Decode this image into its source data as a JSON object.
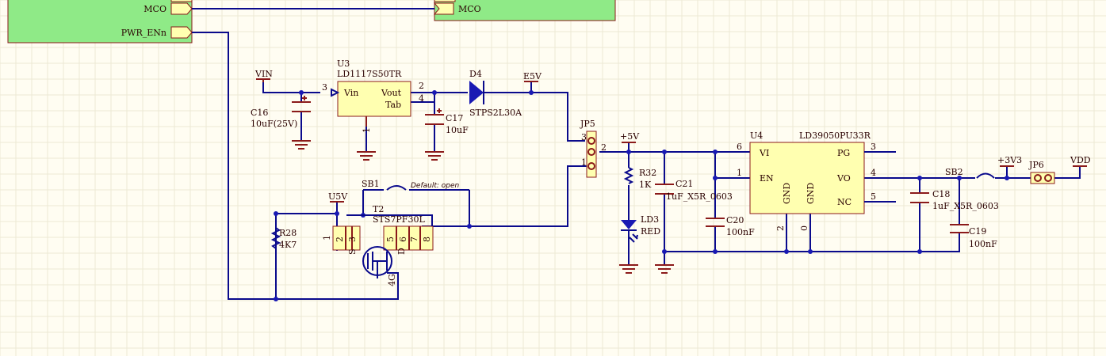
{
  "ports": {
    "mco_left": "MCO",
    "pwr_enn": "PWR_ENn",
    "mco_right": "MCO"
  },
  "nets": {
    "vin": "VIN",
    "e5v": "E5V",
    "u5v": "U5V",
    "p5v": "+5V",
    "p3v3": "+3V3",
    "vdd": "VDD"
  },
  "u3": {
    "ref": "U3",
    "value": "LD1117S50TR",
    "pin_vin": "Vin",
    "pin_vout": "Vout",
    "pin_tab": "Tab",
    "pin3": "3",
    "pin2": "2",
    "pin4": "4",
    "pin1": "1"
  },
  "c16": {
    "ref": "C16",
    "value": "10uF(25V)"
  },
  "c17": {
    "ref": "C17",
    "value": "10uF"
  },
  "d4": {
    "ref": "D4",
    "value": "STPS2L30A"
  },
  "jp5": {
    "ref": "JP5",
    "pin3": "3",
    "pin2": "2",
    "pin1": "1"
  },
  "sb1": {
    "ref": "SB1",
    "note": "Default: open"
  },
  "t2": {
    "ref": "T2",
    "value": "STS7PF30L",
    "pins": [
      "1",
      "2",
      "3",
      "5",
      "6",
      "7",
      "8"
    ],
    "s": "S",
    "d": "D",
    "g": "4G"
  },
  "r28": {
    "ref": "R28",
    "value": "4K7"
  },
  "r32": {
    "ref": "R32",
    "value": "1K"
  },
  "ld3": {
    "ref": "LD3",
    "value": "RED"
  },
  "c21": {
    "ref": "C21",
    "value": "1uF_X5R_0603"
  },
  "c20": {
    "ref": "C20",
    "value": "100nF"
  },
  "u4": {
    "ref": "U4",
    "value": "LD39050PU33R",
    "pin_vi": "VI",
    "pin_en": "EN",
    "pin_pg": "PG",
    "pin_vo": "VO",
    "pin_nc": "NC",
    "pin_gnd1": "GND",
    "pin_gnd2": "GND",
    "pin6": "6",
    "pin1": "1",
    "pin3": "3",
    "pin4": "4",
    "pin5": "5",
    "pin2": "2",
    "pin0": "0"
  },
  "c18": {
    "ref": "C18",
    "value": "1uF_X5R_0603"
  },
  "c19": {
    "ref": "C19",
    "value": "100nF"
  },
  "sb2": {
    "ref": "SB2"
  },
  "jp6": {
    "ref": "JP6"
  },
  "colors": {
    "wire": "#0a0a8c",
    "component": "#8b1a1a",
    "part_fill": "#ffffb0",
    "sheet_fill": "#8fea87",
    "background": "#fffdf2"
  }
}
